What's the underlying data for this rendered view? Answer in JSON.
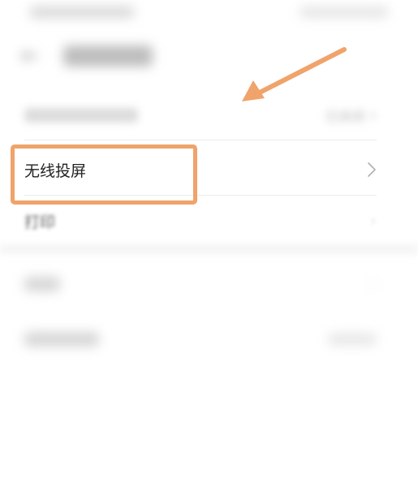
{
  "status_bar": {
    "left": "",
    "right": ""
  },
  "header": {
    "title": ""
  },
  "rows": [
    {
      "label": "",
      "value": "已关闭"
    },
    {
      "label": "无线投屏",
      "value": ""
    },
    {
      "label": "打印",
      "value": ""
    },
    {
      "label": "",
      "value": ""
    },
    {
      "label": "",
      "value": ""
    }
  ],
  "colors": {
    "highlight": "#f0a36a",
    "arrow": "#f0a36a"
  },
  "icons": {
    "back": "back-arrow-icon",
    "chevron": "chevron-right-icon"
  }
}
